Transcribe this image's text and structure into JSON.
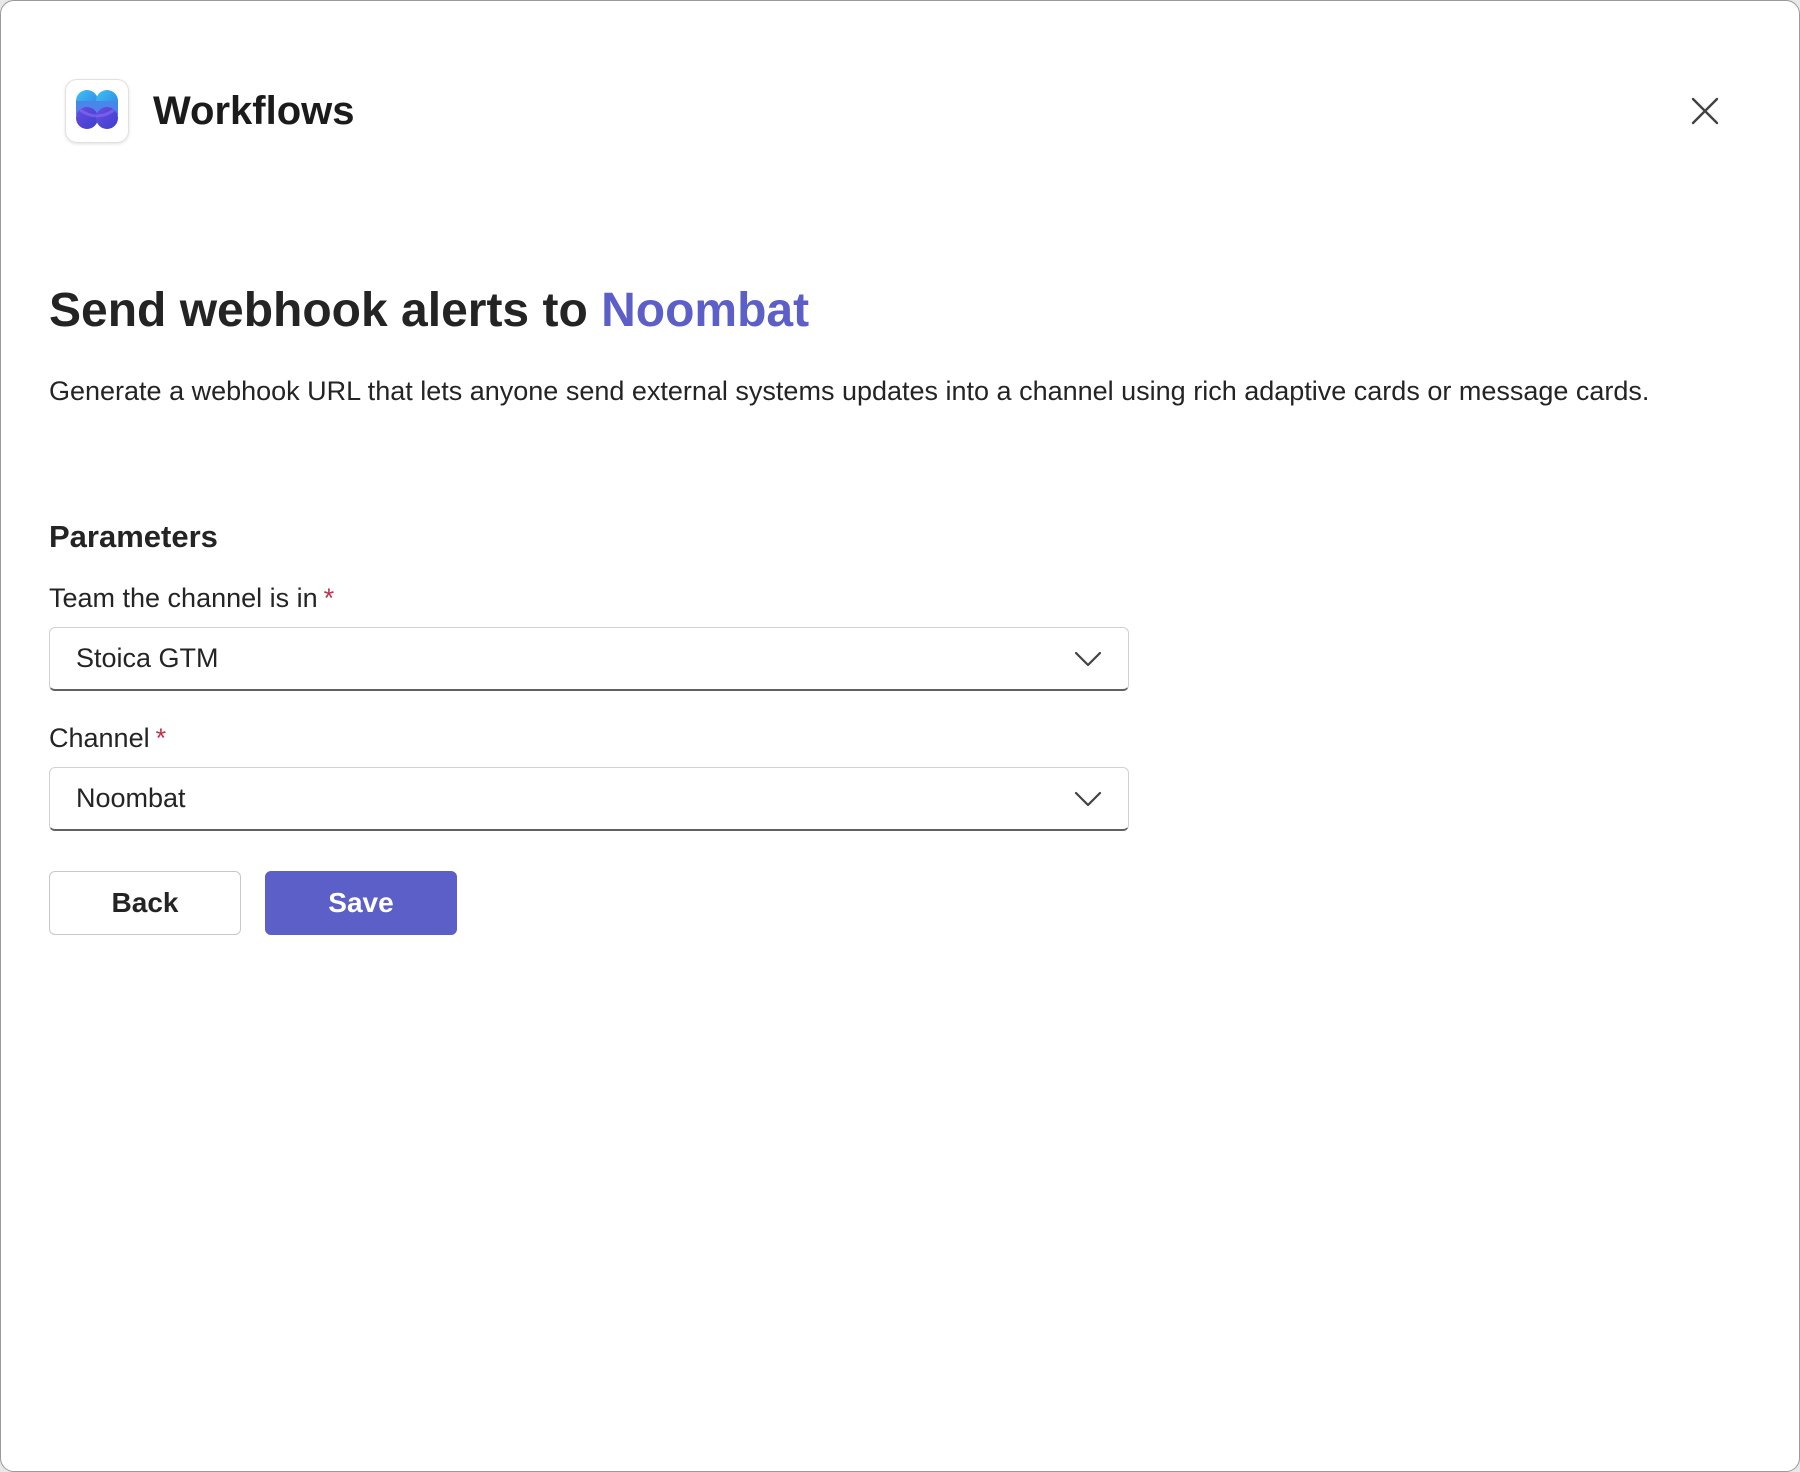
{
  "header": {
    "app_title": "Workflows",
    "app_icon": "workflows-logo-icon",
    "close_icon": "close-icon"
  },
  "main": {
    "headline_prefix": "Send webhook alerts to",
    "headline_accent": "Noombat",
    "description": "Generate a webhook URL that lets anyone send external systems updates into a channel using rich adaptive cards or message cards.",
    "section_title": "Parameters",
    "fields": [
      {
        "label": "Team the channel is in",
        "required_mark": "*",
        "value": "Stoica GTM"
      },
      {
        "label": "Channel",
        "required_mark": "*",
        "value": "Noombat"
      }
    ]
  },
  "actions": {
    "back_label": "Back",
    "save_label": "Save"
  },
  "colors": {
    "accent": "#5b5fc7",
    "required": "#c4314b",
    "text": "#242424"
  }
}
